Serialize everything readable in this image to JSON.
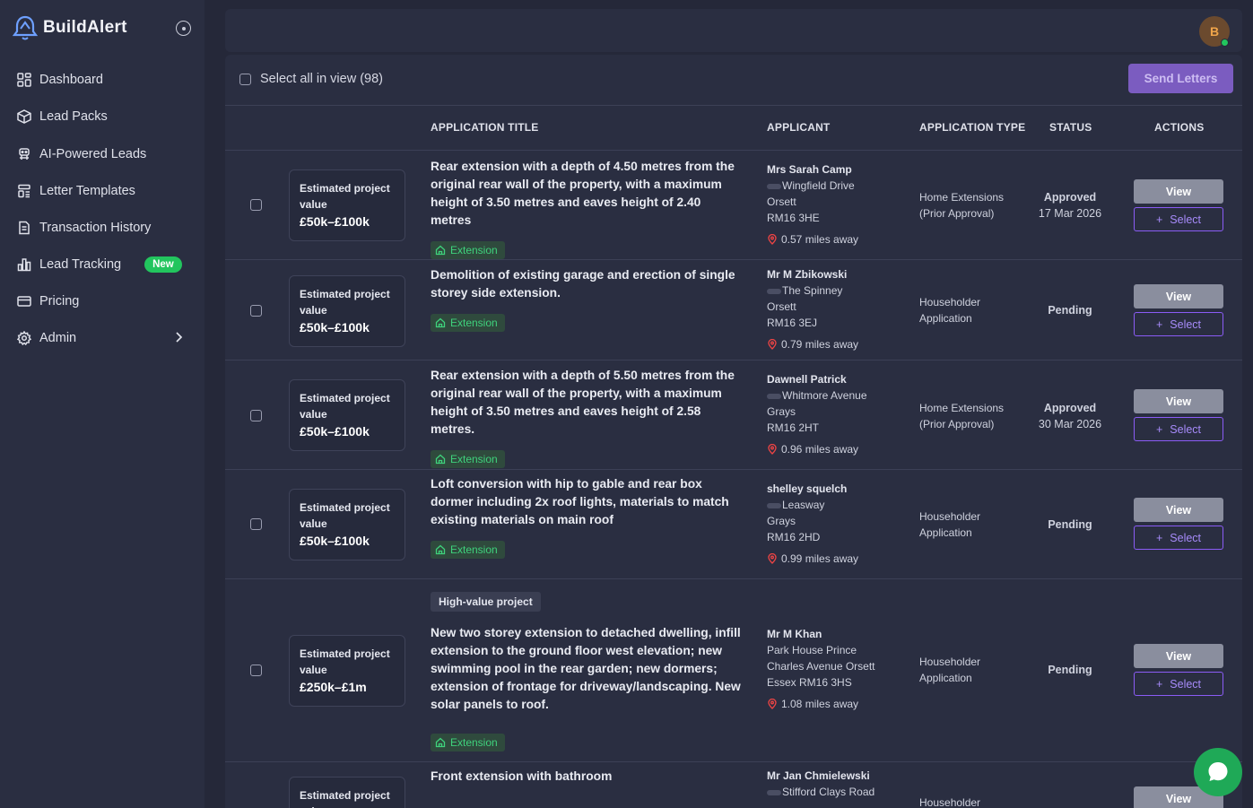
{
  "app": {
    "name": "BuildAlert"
  },
  "sidebar": {
    "items": [
      {
        "label": "Dashboard",
        "icon": "dashboard-icon"
      },
      {
        "label": "Lead Packs",
        "icon": "package-icon"
      },
      {
        "label": "AI-Powered Leads",
        "icon": "ai-icon"
      },
      {
        "label": "Letter Templates",
        "icon": "template-icon"
      },
      {
        "label": "Transaction History",
        "icon": "receipt-icon"
      },
      {
        "label": "Lead Tracking",
        "icon": "bar-chart-icon",
        "badge": "New"
      },
      {
        "label": "Pricing",
        "icon": "credit-card-icon"
      },
      {
        "label": "Admin",
        "icon": "gear-icon"
      }
    ]
  },
  "header": {
    "avatar_initial": "B"
  },
  "toolbar": {
    "select_all_label": "Select all in view (98)",
    "send_letters_label": "Send Letters"
  },
  "table": {
    "headers": {
      "title": "APPLICATION TITLE",
      "applicant": "APPLICANT",
      "type": "APPLICATION TYPE",
      "status": "STATUS",
      "actions": "ACTIONS"
    },
    "est_label_1": "Estimated project",
    "est_label_2": "value",
    "view_label": "View",
    "select_label": "Select",
    "rows": [
      {
        "est_value": "£50k–£100k",
        "title": "Rear extension with a depth of 4.50 metres from the original rear wall of the property, with a maximum height of 3.50 metres and eaves height of 2.40 metres",
        "tag": "Extension",
        "applicant_name": "Mrs Sarah Camp",
        "address_1": "Wingfield Drive",
        "address_2": "Orsett",
        "address_3": "RM16 3HE",
        "distance": "0.57 miles away",
        "type_1": "Home Extensions",
        "type_2": "(Prior Approval)",
        "status": "Approved",
        "status_date": "17 Mar 2026"
      },
      {
        "est_value": "£50k–£100k",
        "title": "Demolition of existing garage and erection of single storey side extension.",
        "tag": "Extension",
        "applicant_name": "Mr M Zbikowski",
        "address_1": "The Spinney",
        "address_2": "Orsett",
        "address_3": "RM16 3EJ",
        "distance": "0.79 miles away",
        "type_1": "Householder",
        "type_2": "Application",
        "status": "Pending",
        "status_date": ""
      },
      {
        "est_value": "£50k–£100k",
        "title": "Rear extension with a depth of 5.50 metres from the original rear wall of the property, with a maximum height of 3.50 metres and eaves height of 2.58 metres.",
        "tag": "Extension",
        "applicant_name": "Dawnell Patrick",
        "address_1": "Whitmore Avenue",
        "address_2": "Grays",
        "address_3": "RM16 2HT",
        "distance": "0.96 miles away",
        "type_1": "Home Extensions",
        "type_2": "(Prior Approval)",
        "status": "Approved",
        "status_date": "30 Mar 2026"
      },
      {
        "est_value": "£50k–£100k",
        "title": "Loft conversion with hip to gable and rear box dormer including 2x roof lights, materials to match existing materials on main roof",
        "tag": "Extension",
        "applicant_name": "shelley squelch",
        "address_1": "Leasway",
        "address_2": "Grays",
        "address_3": "RM16 2HD",
        "distance": "0.99 miles away",
        "type_1": "Householder",
        "type_2": "Application",
        "status": "Pending",
        "status_date": ""
      },
      {
        "est_value": "£250k–£1m",
        "high_value": "High-value project",
        "title": "New two storey extension to detached dwelling, infill extension to the ground floor west elevation; new swimming pool in the rear garden; new dormers; extension of frontage for driveway/landscaping. New solar panels to roof.",
        "tag": "Extension",
        "applicant_name": "Mr M Khan",
        "address_1": "Park House Prince",
        "address_2": "Charles Avenue Orsett",
        "address_3": "Essex RM16 3HS",
        "distance": "1.08 miles away",
        "type_1": "Householder",
        "type_2": "Application",
        "status": "Pending",
        "status_date": ""
      },
      {
        "est_value": "",
        "title": "Front extension with bathroom",
        "applicant_name": "Mr Jan Chmielewski",
        "address_1": "Stifford Clays Road",
        "type_1": "Householder",
        "status": "",
        "status_date": ""
      }
    ]
  },
  "colors": {
    "background": "#252839",
    "panel": "#2a2e41",
    "accent_purple": "#8b5cf6",
    "success_green": "#22c55e",
    "distance_pin": "#ef4444"
  }
}
